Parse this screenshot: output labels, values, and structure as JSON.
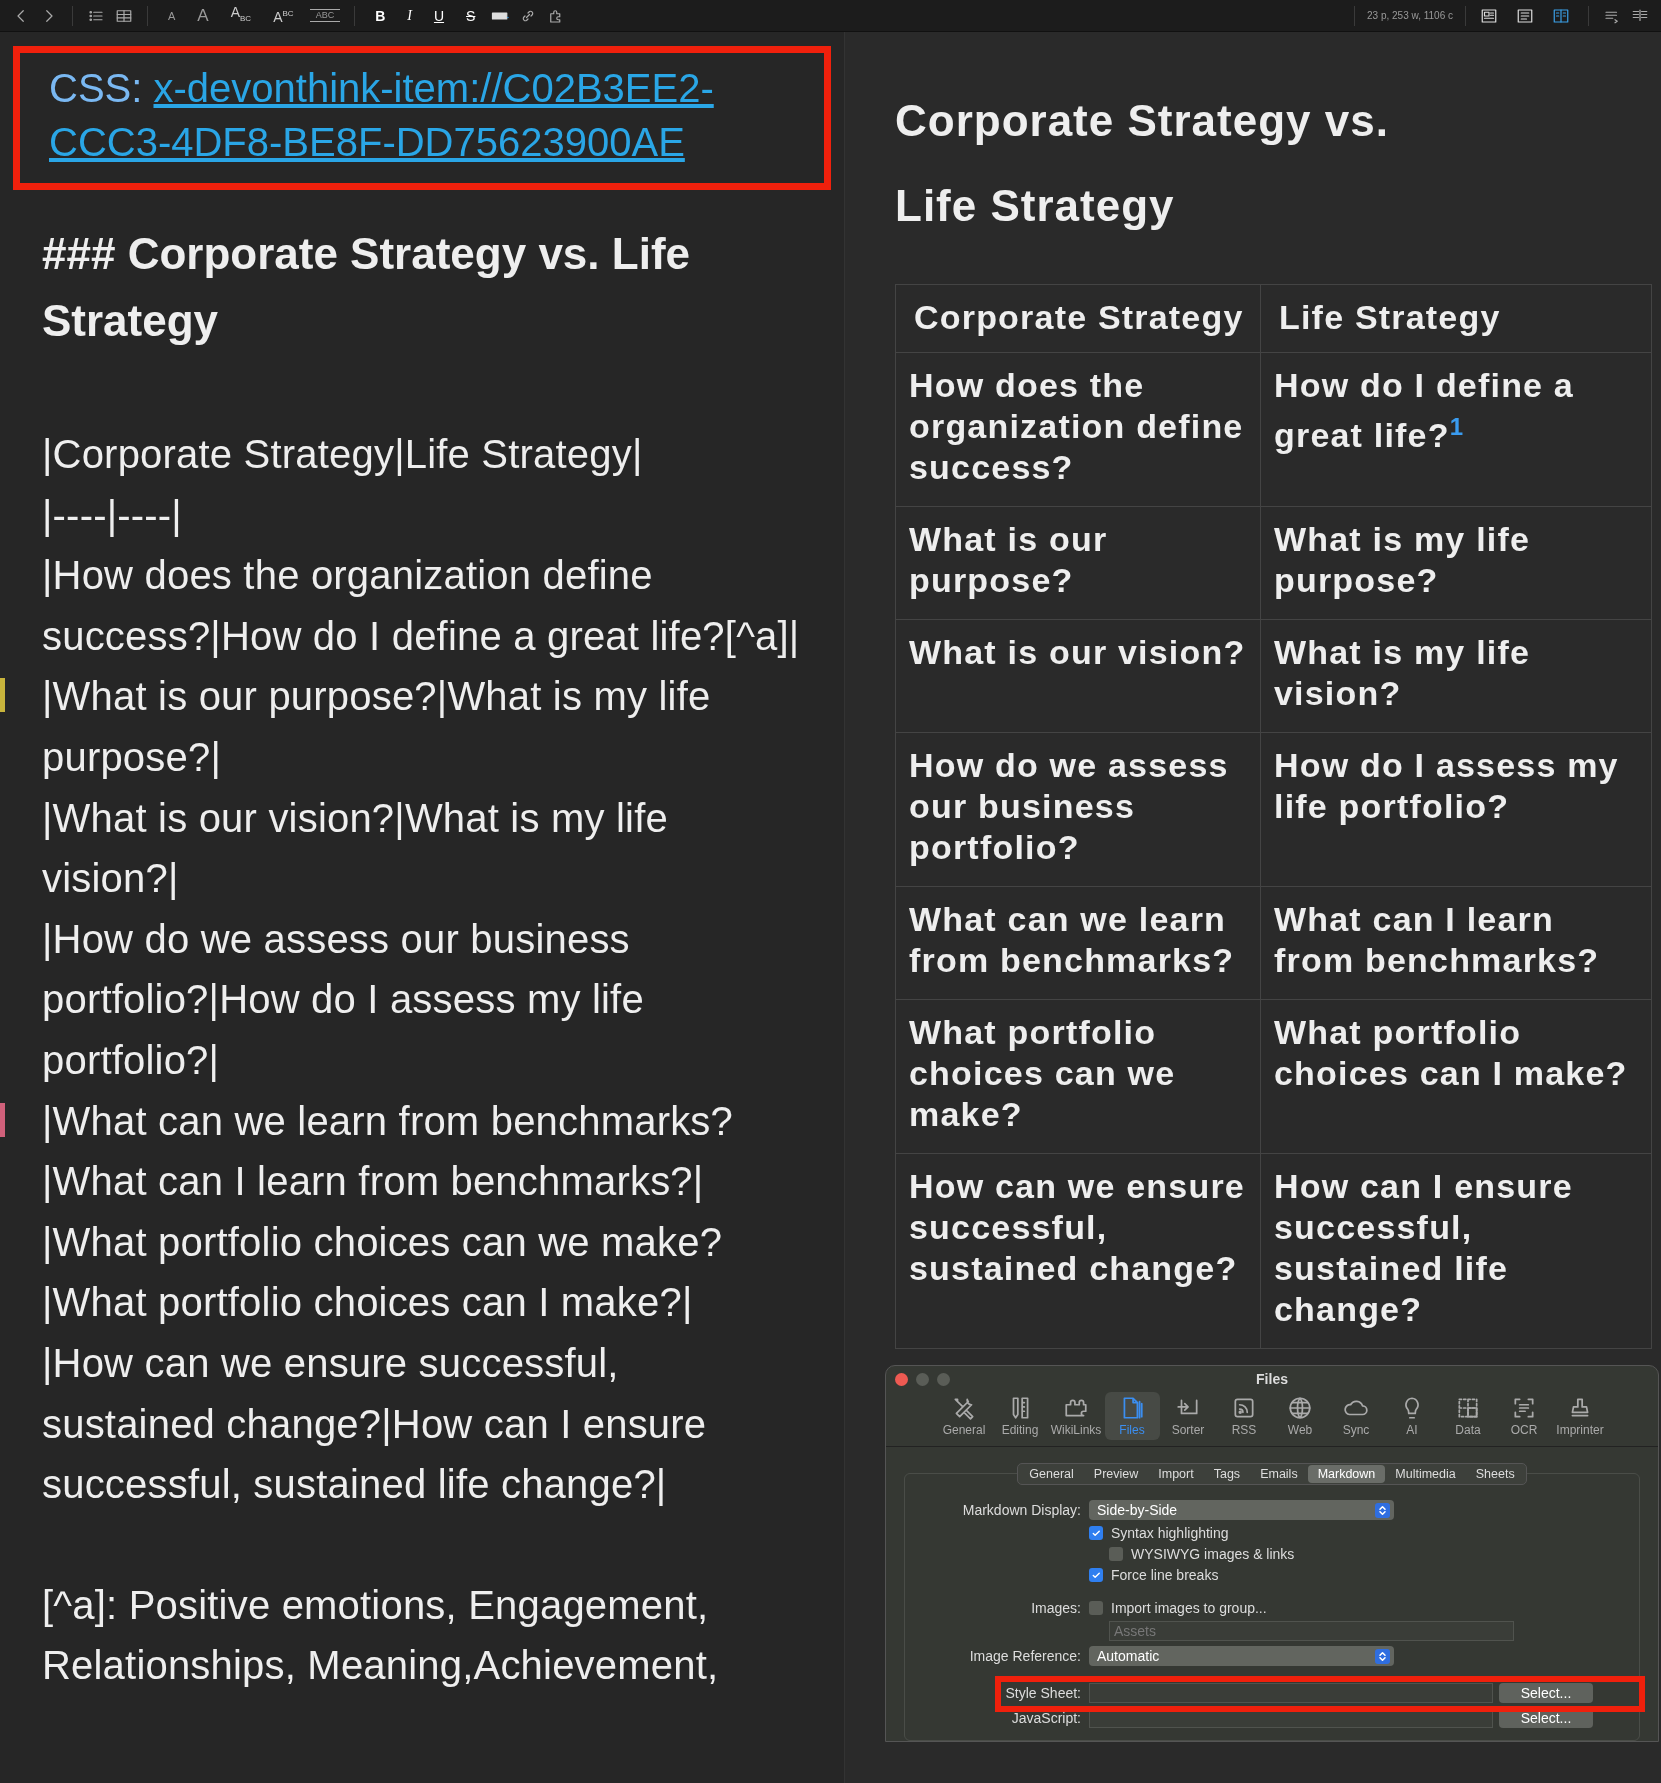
{
  "toolbar": {
    "format_buttons": [
      {
        "text": "A",
        "kind": "small"
      },
      {
        "text": "A",
        "kind": "large"
      },
      {
        "text": "A$_{BC}$",
        "kind": "plain"
      },
      {
        "text": "A$^{BC}$",
        "kind": "plain"
      },
      {
        "text": "ABC",
        "kind": "ruled"
      },
      {
        "text": "B",
        "kind": "bold"
      },
      {
        "text": "I",
        "kind": "italic"
      },
      {
        "text": "U",
        "kind": "underline"
      },
      {
        "text": "S",
        "kind": "strike"
      }
    ],
    "word_count": "23 p, 253 w, 1106 c",
    "view_modes": [
      {
        "selected": false
      },
      {
        "selected": false
      },
      {
        "selected": true
      }
    ]
  },
  "editor": {
    "link_block": {
      "label": "CSS:",
      "link": "x-devonthink-item://C02B3EE2-CCC3-4DF8-BE8F-DD75623900AE",
      "highlighted": true
    },
    "heading": "### Corporate Strategy vs. Life Strategy",
    "lines": [
      {
        "text": "|Corporate Strategy|Life Strategy|"
      },
      {
        "text": "|----|----|"
      },
      {
        "text": "|How does the organization define success?|How do I define a great life?[^a]|"
      },
      {
        "text": "|What is our purpose?|What is my life purpose?|",
        "color": "#c8b43c"
      },
      {
        "text": "|What is our vision?|What is my life vision?|"
      },
      {
        "text": "|How do we assess our business portfolio?|How do I assess my life portfolio?|"
      },
      {
        "text": "|What can we learn from benchmarks?|What can I learn from benchmarks?|",
        "color": "#d0607a"
      },
      {
        "text": "|What portfolio choices can we make?|What portfolio choices can I make?|"
      },
      {
        "text": "|How can we ensure successful, sustained change?|How can I ensure successful, sustained life change?|"
      }
    ],
    "footnote": "[^a]: Positive emotions, Engagement, Relationships, Meaning,Achievement,"
  },
  "preview": {
    "title": "Corporate Strategy vs. Life Strategy",
    "table": {
      "columns": [
        "Corporate Strategy",
        "Life Strategy"
      ],
      "rows": [
        [
          "How does the organization define success?",
          "How do I define a great life?$^{1}$"
        ],
        [
          "What is our purpose?",
          "What is my life purpose?"
        ],
        [
          "What is our vision?",
          "What is my life vision?"
        ],
        [
          "How do we assess our business portfolio?",
          "How do I assess my life portfolio?"
        ],
        [
          "What can we learn from benchmarks?",
          "What can I learn from benchmarks?"
        ],
        [
          "What portfolio choices can we make?",
          "What portfolio choices can I make?"
        ],
        [
          "How can we ensure successful, sustained change?",
          "How can I ensure successful, sustained life change?"
        ]
      ]
    }
  },
  "settings": {
    "title": "Files",
    "toolbar": [
      {
        "label": "General",
        "selected": false
      },
      {
        "label": "Editing",
        "selected": false
      },
      {
        "label": "WikiLinks",
        "selected": false
      },
      {
        "label": "Files",
        "selected": true
      },
      {
        "label": "Sorter",
        "selected": false
      },
      {
        "label": "RSS",
        "selected": false
      },
      {
        "label": "Web",
        "selected": false
      },
      {
        "label": "Sync",
        "selected": false
      },
      {
        "label": "AI",
        "selected": false
      },
      {
        "label": "Data",
        "selected": false
      },
      {
        "label": "OCR",
        "selected": false
      },
      {
        "label": "Imprinter",
        "selected": false
      }
    ],
    "tabs": [
      {
        "label": "General",
        "selected": false
      },
      {
        "label": "Preview",
        "selected": false
      },
      {
        "label": "Import",
        "selected": false
      },
      {
        "label": "Tags",
        "selected": false
      },
      {
        "label": "Emails",
        "selected": false
      },
      {
        "label": "Markdown",
        "selected": true
      },
      {
        "label": "Multimedia",
        "selected": false
      },
      {
        "label": "Sheets",
        "selected": false
      }
    ],
    "rows": [
      {
        "kind": "popup",
        "label": "Markdown Display:",
        "value": "Side-by-Side"
      },
      {
        "kind": "checkbox",
        "text": "Syntax highlighting",
        "checked": true
      },
      {
        "kind": "subcheckbox",
        "text": "WYSIWYG images & links",
        "checked": false
      },
      {
        "kind": "checkbox",
        "text": "Force line breaks",
        "checked": true
      },
      {
        "kind": "checkbox",
        "label": "Images:",
        "text": "Import images to group...",
        "checked": false
      },
      {
        "kind": "field",
        "placeholder": "Assets"
      },
      {
        "kind": "popup",
        "label": "Image Reference:",
        "value": "Automatic"
      },
      {
        "kind": "file",
        "label": "Style Sheet:",
        "button": "Select...",
        "highlighted": true
      },
      {
        "kind": "file",
        "label": "JavaScript:",
        "button": "Select...",
        "highlighted": false
      }
    ]
  }
}
